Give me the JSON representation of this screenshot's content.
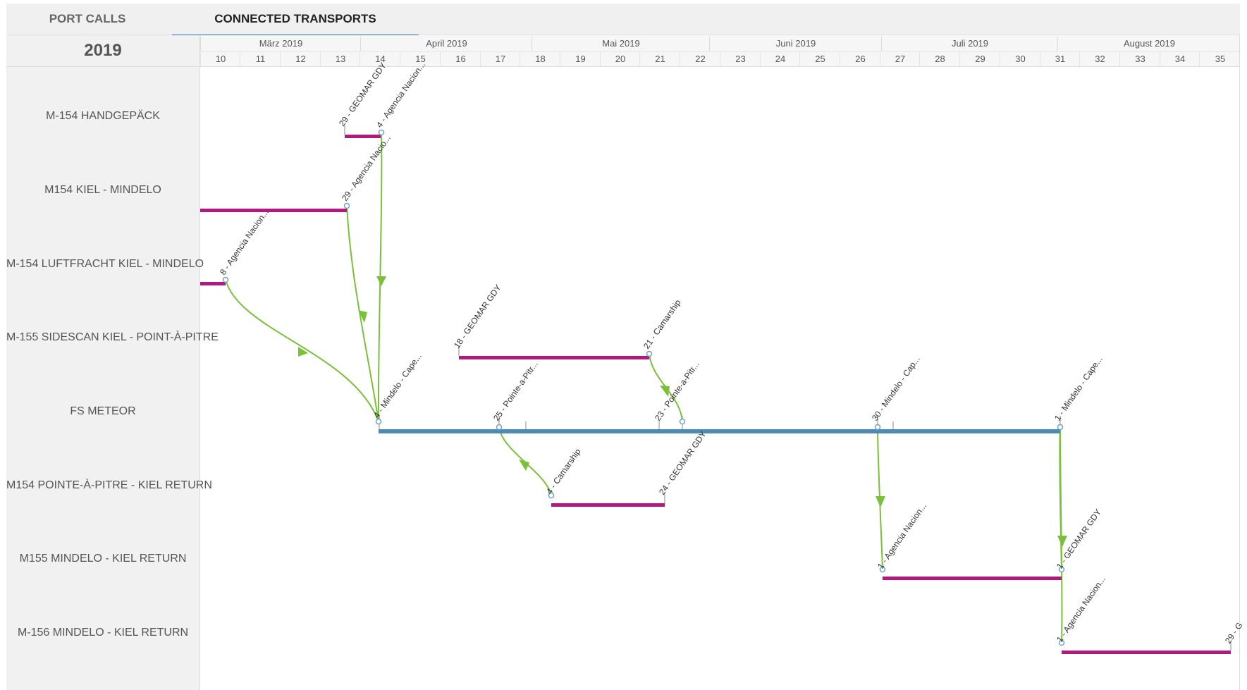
{
  "tabs": [
    {
      "label": "PORT CALLS",
      "active": false
    },
    {
      "label": "CONNECTED TRANSPORTS",
      "active": true
    }
  ],
  "year": "2019",
  "months": [
    "März 2019",
    "April 2019",
    "Mai 2019",
    "Juni 2019",
    "Juli 2019",
    "August 2019"
  ],
  "weeks": [
    "10",
    "11",
    "12",
    "13",
    "14",
    "15",
    "16",
    "17",
    "18",
    "19",
    "20",
    "21",
    "22",
    "23",
    "24",
    "25",
    "26",
    "27",
    "28",
    "29",
    "30",
    "31",
    "32",
    "33",
    "34",
    "35"
  ],
  "rows": [
    "M-154 HANDGEPÄCK",
    "M154 KIEL - MINDELO",
    "M-154 LUFTFRACHT KIEL - MINDELO",
    "M-155 SIDESCAN KIEL - POINT-À-PITRE",
    "FS METEOR",
    "M154 POINTE-À-PITRE - KIEL RETURN",
    "M155 MINDELO - KIEL RETURN",
    "M-156 MINDELO - KIEL RETURN"
  ],
  "port_labels": [
    "29 - GEOMAR GDY",
    "4 - Agencia Nacion...",
    "29 - Agencia Nacio...",
    "8 - Agencia Nacion...",
    "18 - GEOMAR GDY",
    "21 - Camarship",
    "4 - Mindelo - Cape...",
    "25 - Pointe-a-Pitr...",
    "23 - Pointe-a-Pitr...",
    "30 - Mindelo - Cap...",
    "1 - Mindelo - Cape...",
    "4 - Camarship",
    "24 - GEOMAR GDY",
    "1 - Agencia Nacion...",
    "1 - GEOMAR GDY",
    "1 - Agencia Nacion...",
    "29 - G"
  ],
  "colors": {
    "cargo_bar": "#b0197e",
    "vessel_bar": "#4d8bb6",
    "connector": "#7bbf3a"
  }
}
